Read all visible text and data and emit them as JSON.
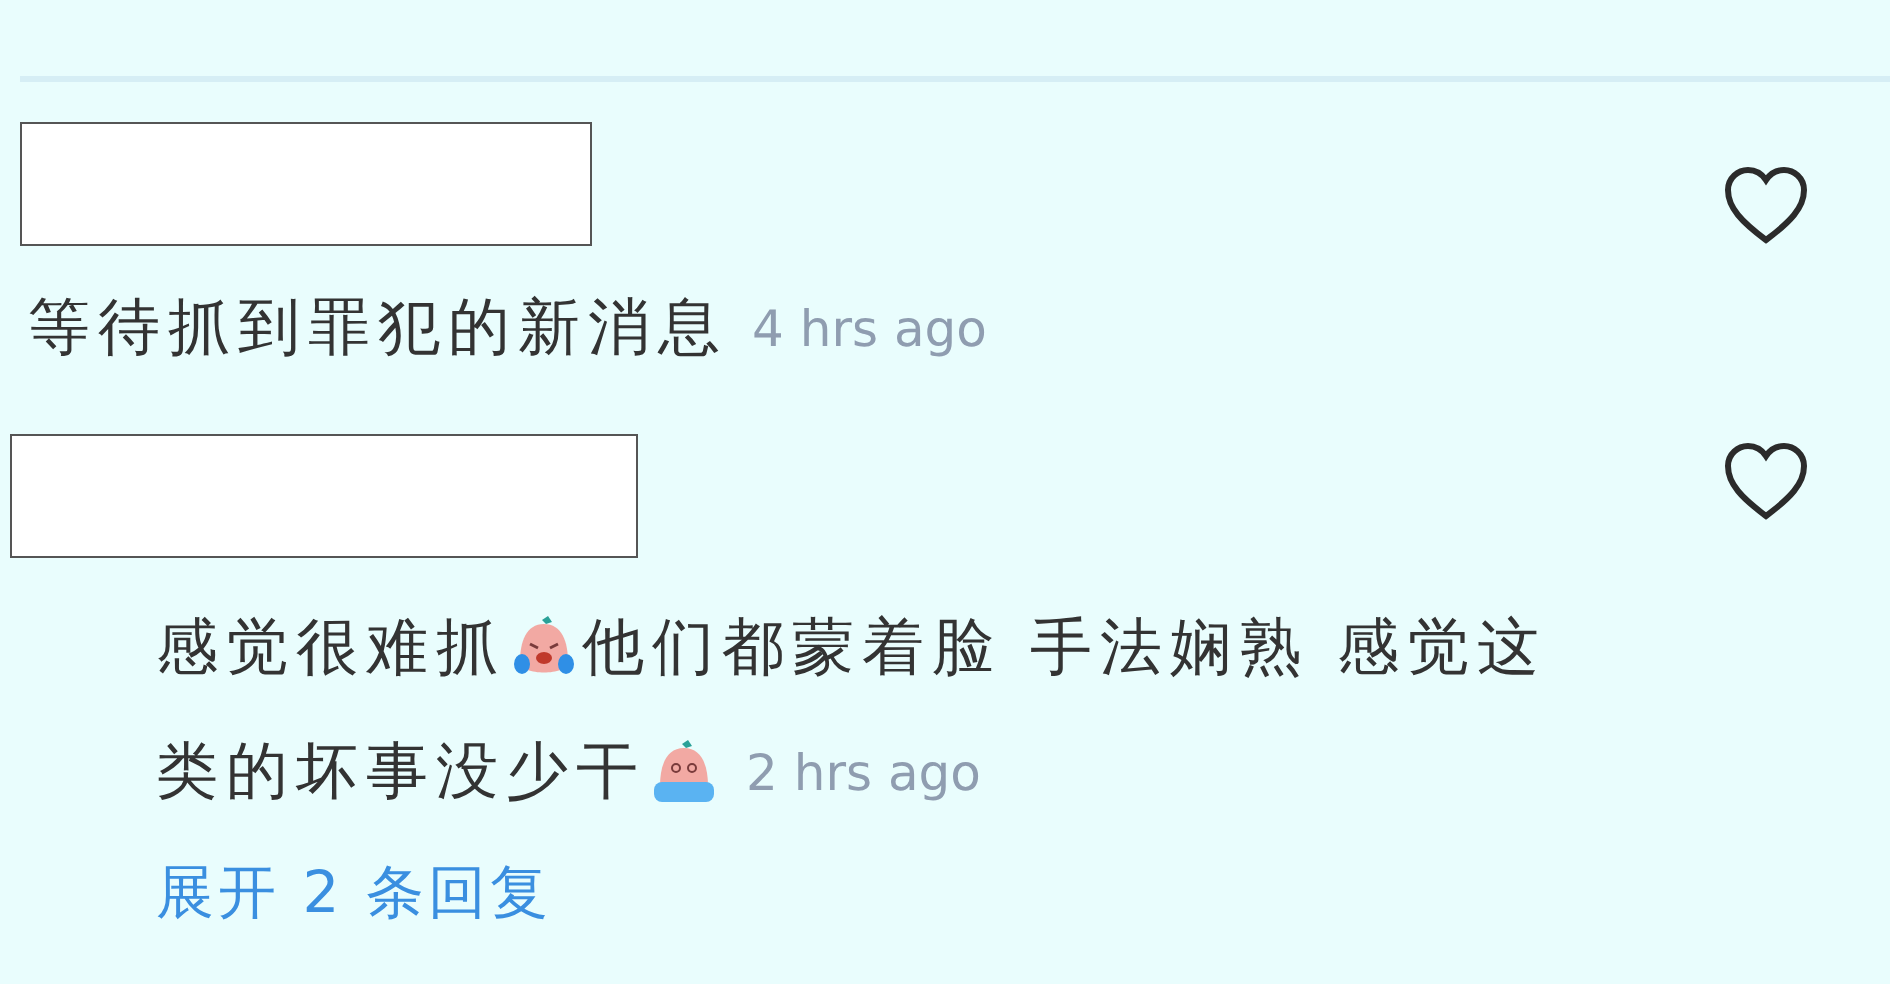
{
  "comments": [
    {
      "redacted": true,
      "liked": false,
      "indented": false,
      "lines": [
        [
          {
            "kind": "text",
            "text": "等待抓到罪犯的新消息"
          }
        ]
      ],
      "time": "4 hrs ago"
    },
    {
      "redacted": true,
      "liked": false,
      "indented": true,
      "lines": [
        [
          {
            "kind": "text",
            "text": "感觉很难抓"
          },
          {
            "kind": "emoji-tears"
          },
          {
            "kind": "text",
            "text": "他们都蒙着脸 手法娴熟 感觉这"
          }
        ],
        [
          {
            "kind": "text",
            "text": "类的坏事没少干"
          },
          {
            "kind": "emoji-tub"
          }
        ]
      ],
      "time": "2 hrs ago",
      "replies_link": "展开 2 条回复"
    }
  ]
}
